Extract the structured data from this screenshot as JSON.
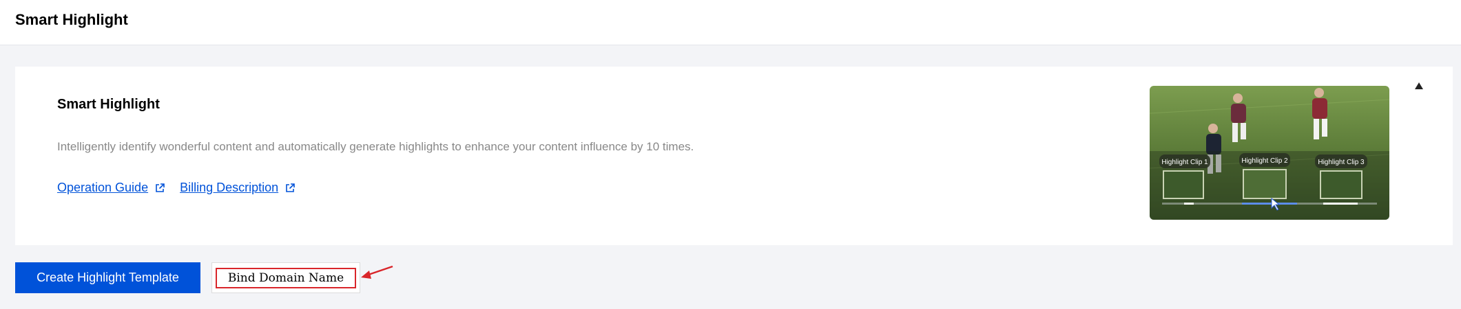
{
  "header": {
    "title": "Smart Highlight"
  },
  "card": {
    "title": "Smart Highlight",
    "description": "Intelligently identify wonderful content and automatically generate highlights to enhance your content influence by 10 times.",
    "links": [
      {
        "label": "Operation Guide",
        "icon": "external-link-icon"
      },
      {
        "label": "Billing Description",
        "icon": "external-link-icon"
      }
    ],
    "thumbnail": {
      "clips": [
        "Highlight Clip 1",
        "Highlight Clip 2",
        "Highlight Clip 3"
      ]
    },
    "collapse_icon": "caret-up-icon"
  },
  "actions": {
    "create_label": "Create Highlight Template",
    "bind_label": "Bind Domain Name"
  },
  "colors": {
    "primary": "#0052d9",
    "annotation": "#d9252a",
    "text_muted": "#888888"
  }
}
